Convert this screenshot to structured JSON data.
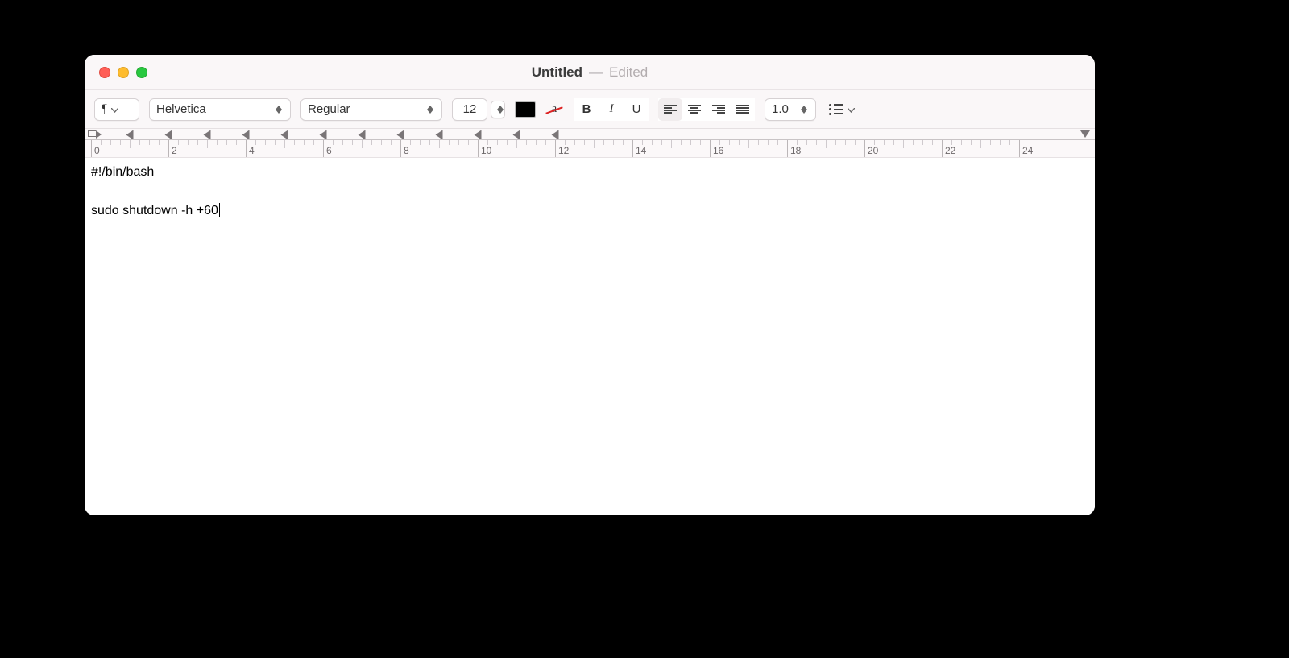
{
  "titlebar": {
    "title": "Untitled",
    "dash": "—",
    "status": "Edited"
  },
  "toolbar": {
    "paragraph_glyph": "¶",
    "font_family": "Helvetica",
    "font_style": "Regular",
    "font_size": "12",
    "bold": "B",
    "italic": "I",
    "underline": "U",
    "strike_a": "a",
    "line_spacing": "1.0"
  },
  "ruler": {
    "labels": [
      "0",
      "2",
      "4",
      "6",
      "8",
      "10",
      "12",
      "14",
      "16",
      "18",
      "20",
      "22",
      "24"
    ],
    "tab_count": 12
  },
  "document": {
    "line1": "#!/bin/bash",
    "line2": "",
    "line3": "sudo shutdown -h +60"
  }
}
